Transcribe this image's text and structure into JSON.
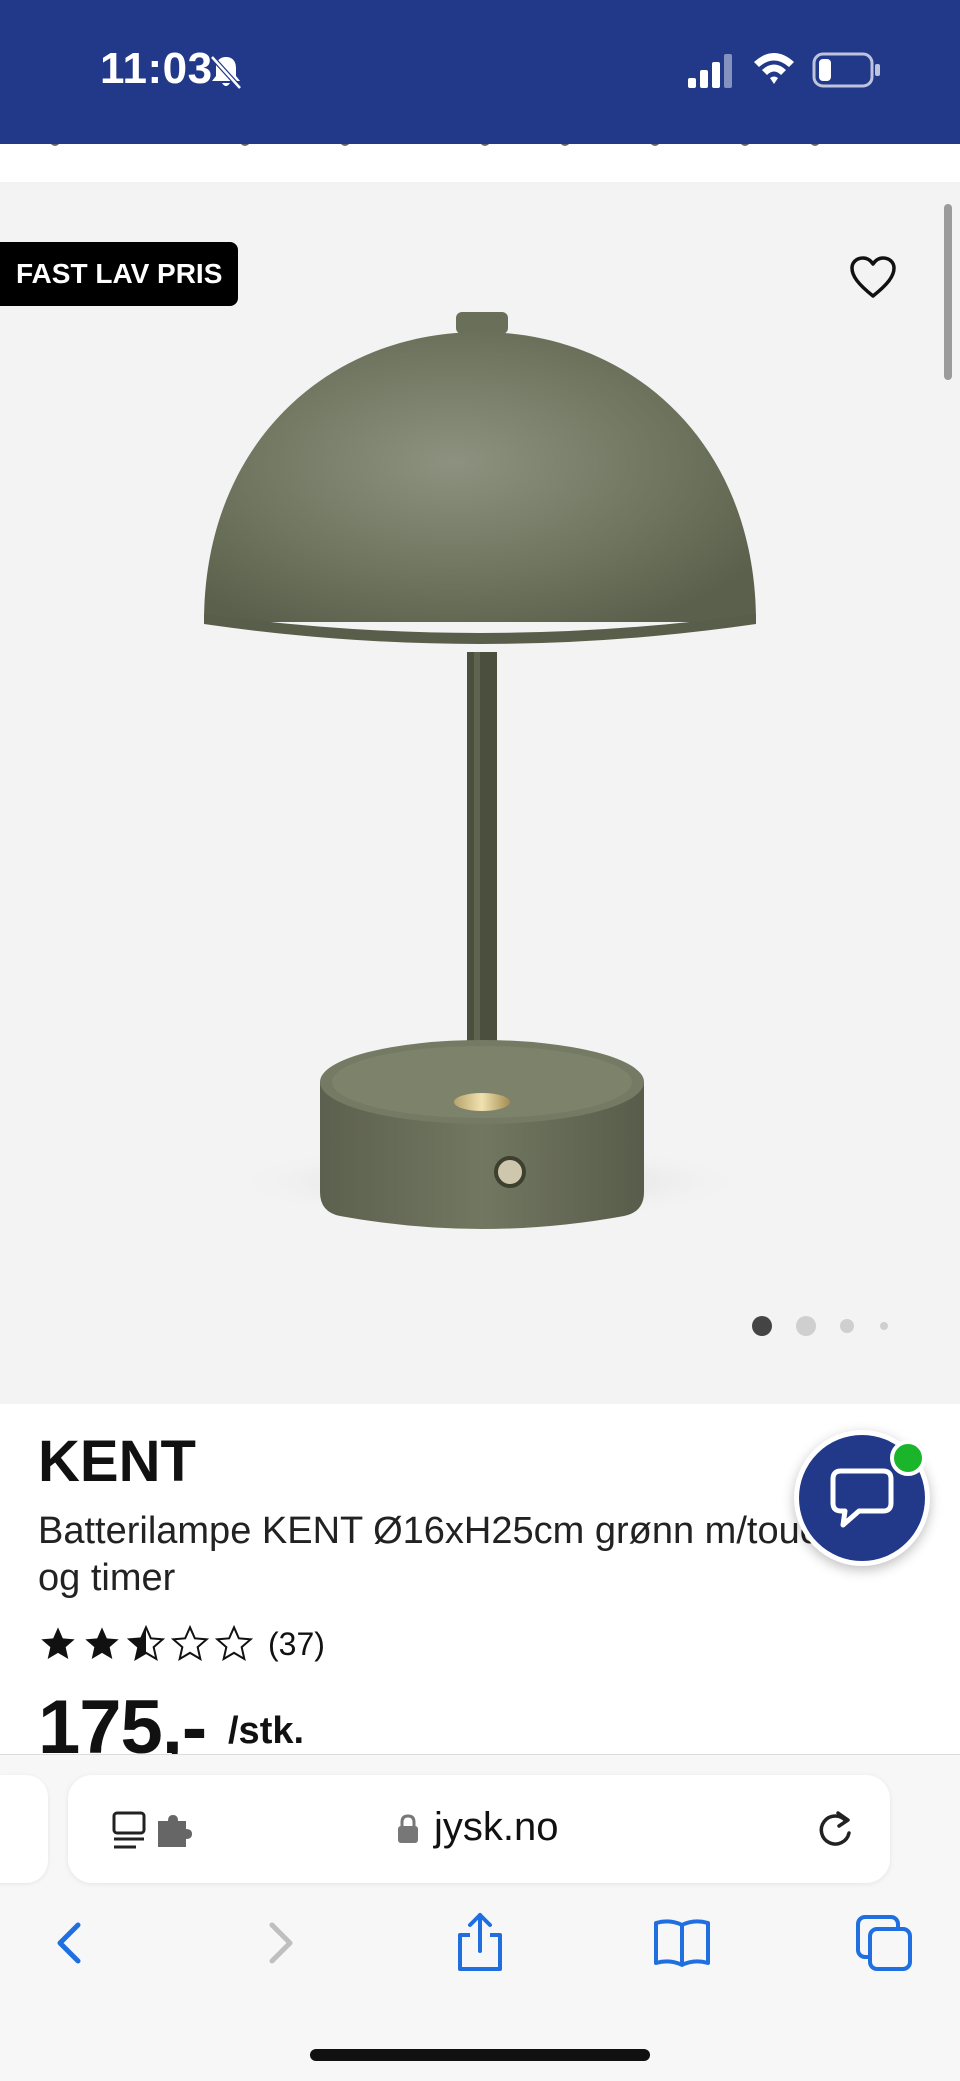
{
  "status_bar": {
    "time": "11:03",
    "bg_color": "#22398a",
    "icons": [
      "bell-muted-icon",
      "signal-icon",
      "wifi-icon",
      "battery-icon"
    ]
  },
  "gallery": {
    "badge": "FAST LAV PRIS",
    "favorite_icon": "heart-icon",
    "image_count": 4,
    "active_index": 0
  },
  "product": {
    "brand": "KENT",
    "name": "Batterilampe KENT Ø16xH25cm grønn m/touch og timer",
    "rating": 2.5,
    "rating_max": 5,
    "review_count": "(37)",
    "price": "175,-",
    "price_unit": "/stk."
  },
  "chat": {
    "icon": "chat-bubble-icon",
    "online_color": "#1bb52b",
    "button_color": "#22398a"
  },
  "browser": {
    "url": "jysk.no",
    "toolbar_icons": [
      "back-icon",
      "forward-icon",
      "share-icon",
      "bookmarks-icon",
      "tabs-icon"
    ]
  }
}
